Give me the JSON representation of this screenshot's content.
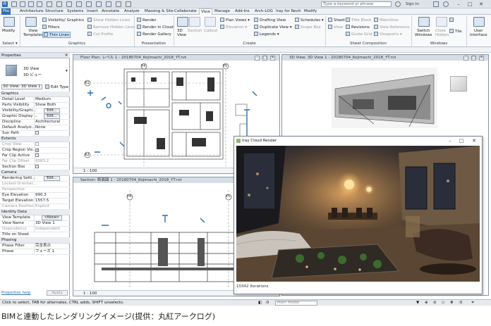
{
  "titlebar": {
    "search_placeholder": "Type a keyword or phrase",
    "signin_label": "Sign In",
    "min": "–",
    "max": "□",
    "close": "✕"
  },
  "tabs": [
    "File",
    "Architecture",
    "Structure",
    "Systems",
    "Insert",
    "Annotate",
    "Analyze",
    "Massing & Site",
    "Collaborate",
    "View",
    "Manage",
    "Add-Ins",
    "Arch-LOG",
    "Iray for Revit",
    "Modify"
  ],
  "active_tab": "View",
  "ribbon": {
    "modify": "Modify",
    "select": "Select",
    "view_templates": "View\nTemplates",
    "visibility": "Visibility/ Graphics",
    "filters": "Filters",
    "thin_lines": "Thin Lines",
    "show_hidden": "Show Hidden Lines",
    "remove_hidden": "Remove Hidden Lines",
    "cut_profile": "Cut Profile",
    "render": "Render",
    "render_cloud": "Render in Cloud",
    "render_gallery": "Render Gallery",
    "view3d": "3D\nView",
    "section": "Section",
    "callout": "Callout",
    "plan_views": "Plan Views",
    "elevation": "Elevation",
    "drafting_view": "Drafting View",
    "duplicate_view": "Duplicate View",
    "legends": "Legends",
    "schedules": "Schedules",
    "scope_box": "Scope Box",
    "sheet": "Sheet",
    "title_block": "Title Block",
    "matchline": "Matchline",
    "view_ref": "View",
    "revisions": "Revisions",
    "view_reference": "View Reference",
    "guide_grid": "Guide Grid",
    "viewports": "Viewports",
    "switch_windows": "Switch\nWindows",
    "close_hidden": "Close\nHidden",
    "replicate": "Replicate",
    "tile": "Tile",
    "user_interface": "User\nInterface",
    "groups": {
      "graphics": "Graphics",
      "presentation": "Presentation",
      "create": "Create",
      "sheet_composition": "Sheet Composition",
      "windows": "Windows",
      "select": "Select ▾"
    }
  },
  "properties": {
    "title": "Properties",
    "type_name": "3D View",
    "type_sub": "3D ビュー",
    "selector": "3D View: 3D View 1",
    "edit_type": "Edit Type",
    "sections": {
      "graphics": "Graphics",
      "extents": "Extents",
      "camera": "Camera",
      "identity": "Identity Data",
      "phasing": "Phasing"
    },
    "rows": {
      "detail_level": [
        "Detail Level",
        "Medium"
      ],
      "parts_visibility": [
        "Parts Visibility",
        "Show Both"
      ],
      "visibility_graphics": [
        "Visibility/Graphi...",
        "Edit..."
      ],
      "graphic_display": [
        "Graphic Display ...",
        "Edit..."
      ],
      "discipline": [
        "Discipline",
        "Architectural"
      ],
      "default_analysis": [
        "Default Analysi...",
        "None"
      ],
      "sun_path": [
        "Sun Path",
        ""
      ],
      "crop_view": [
        "Crop View",
        ""
      ],
      "crop_region": [
        "Crop Region Vis...",
        ""
      ],
      "far_clip_active": [
        "Far Clip Active",
        ""
      ],
      "far_clip_offset": [
        "Far Clip Offset",
        "6083.2"
      ],
      "section_box": [
        "Section Box",
        ""
      ],
      "rendering_settings": [
        "Rendering Setti...",
        "Edit..."
      ],
      "locked_orientation": [
        "Locked Orientat...",
        ""
      ],
      "perspective": [
        "Perspective",
        ""
      ],
      "eye_elevation": [
        "Eye Elevation",
        "990.3"
      ],
      "target_elevation": [
        "Target Elevation",
        "1557.5"
      ],
      "camera_position": [
        "Camera Position",
        "Explicit"
      ],
      "view_template": [
        "View Template",
        "<None>"
      ],
      "view_name": [
        "View Name",
        "3D View 1"
      ],
      "dependency": [
        "Dependency",
        "Independent"
      ],
      "title_on_sheet": [
        "Title on Sheet",
        ""
      ],
      "phase_filter": [
        "Phase Filter",
        "完全表示"
      ],
      "phase": [
        "Phase",
        "フェーズ 1"
      ]
    },
    "help": "Properties help",
    "apply": "Apply"
  },
  "views": {
    "floor_plan": {
      "title": "Floor Plan: レベル 1 - 20180704_Kojimachi_2018_YT.rvt",
      "scale": "1 : 100"
    },
    "view3d": {
      "title": "3D View: 3D View 1 - 20180704_Kojimachi_2018_YT.rvt"
    },
    "section": {
      "title": "Section: 断面図 1 - 20180704_Kojimachi_2018_YT.rvt",
      "scale": "1 : 100"
    },
    "grid_labels": [
      "X1",
      "X2",
      "X3",
      "Y4",
      "Y5"
    ]
  },
  "render_window": {
    "title": "Iray Cloud Render",
    "iterations": "10342 Iterations"
  },
  "status": {
    "hint": "Click to select, TAB for alternates, CTRL adds, SHIFT unselects.",
    "zero": ":0",
    "model": "Main Model"
  },
  "caption": "BIMと連動したレンダリングイメージ(提供：丸紅アークログ)"
}
